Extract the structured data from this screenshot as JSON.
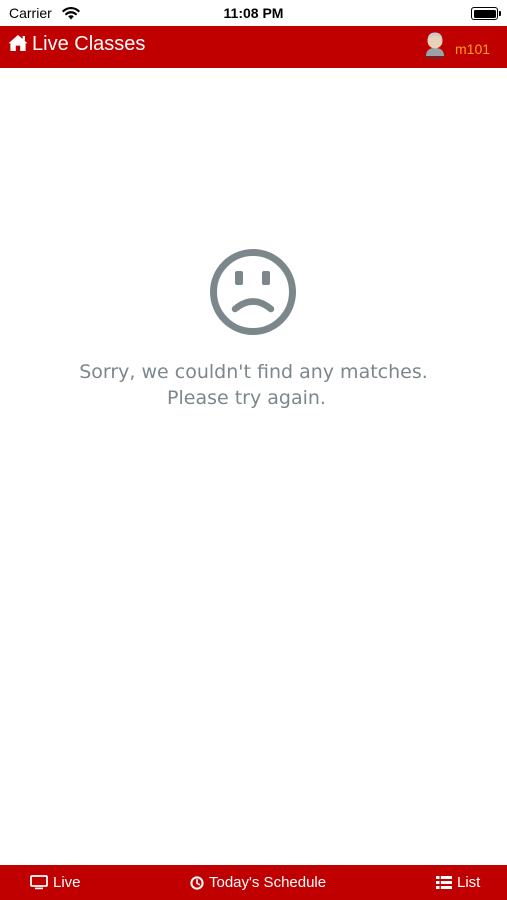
{
  "status_bar": {
    "carrier": "Carrier",
    "time": "11:08 PM"
  },
  "header": {
    "title": "Live Classes",
    "username": "m101",
    "background_color": "#c00000",
    "username_color": "#ffa21a",
    "icons": [
      "home-icon",
      "avatar-icon"
    ]
  },
  "empty_state": {
    "icon": "sad-face-icon",
    "message_line1": "Sorry, we couldn't find any matches.",
    "message_line2": "Please try again.",
    "text_color": "#7c878c"
  },
  "tab_bar": {
    "background_color": "#c00000",
    "tabs": [
      {
        "label": "Live",
        "icon": "monitor-icon"
      },
      {
        "label": "Today's Schedule",
        "icon": "clock-icon"
      },
      {
        "label": "List",
        "icon": "list-icon"
      }
    ]
  }
}
